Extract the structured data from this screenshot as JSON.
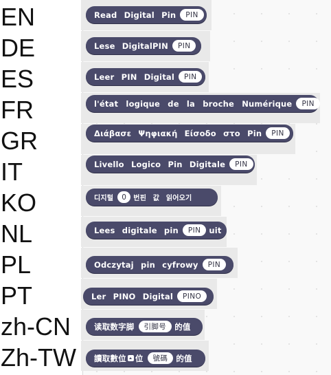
{
  "rows": [
    {
      "lang": "EN",
      "before": "Read Digital Pin",
      "pin": "PIN",
      "after": ""
    },
    {
      "lang": "DE",
      "before": "Lese DigitalPIN",
      "pin": "PIN",
      "after": ""
    },
    {
      "lang": "ES",
      "before": "Leer PIN Digital",
      "pin": "PIN",
      "after": ""
    },
    {
      "lang": "FR",
      "before": "l'état logique de la broche Numérique",
      "pin": "PIN",
      "after": ""
    },
    {
      "lang": "GR",
      "before": "Διάβασε Ψηφιακή Είσοδο στο Pin",
      "pin": "PIN",
      "after": ""
    },
    {
      "lang": "IT",
      "before": "Livello Logico Pin Digitale",
      "pin": "PIN",
      "after": ""
    },
    {
      "lang": "KO",
      "before": "디지털",
      "pin": "0",
      "after": "번핀 값 읽어오기"
    },
    {
      "lang": "NL",
      "before": "Lees digitale pin",
      "pin": "PIN",
      "after": "uit"
    },
    {
      "lang": "PL",
      "before": "Odczytaj pin cyfrowy",
      "pin": "PIN",
      "after": ""
    },
    {
      "lang": "PT",
      "before": "Ler PINO Digital",
      "pin": "PINO",
      "after": ""
    },
    {
      "lang": "zh-CN",
      "before": "读取数字脚",
      "pin": "引脚号",
      "after": "的值"
    },
    {
      "lang": "Zh-TW",
      "before": "讀取數位",
      "pin": "號碼",
      "after": "的值",
      "mid": "位"
    }
  ],
  "colors": {
    "block": "#4a4a6a",
    "pin_bg": "#ffffff",
    "canvas": "#f9f9f9"
  }
}
